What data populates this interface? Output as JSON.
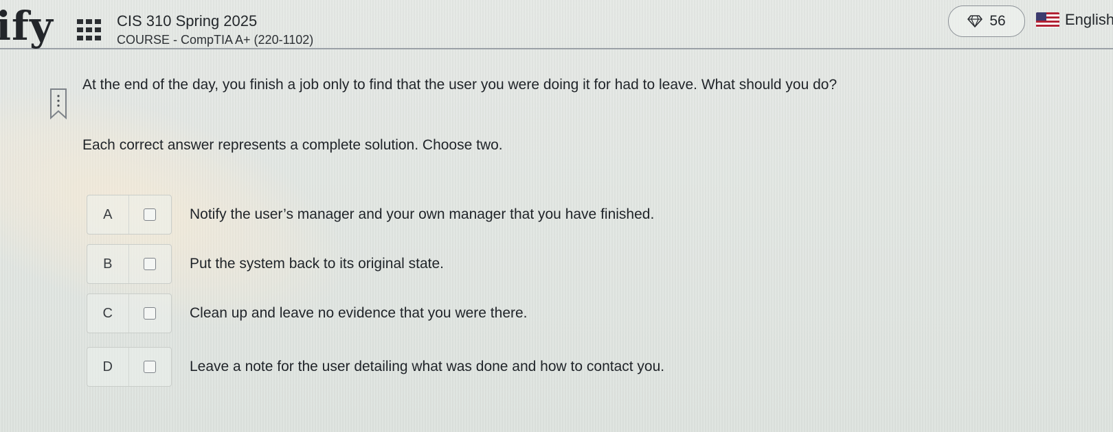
{
  "header": {
    "logo_text": "ify",
    "course_title": "CIS 310 Spring 2025",
    "course_subtitle": "COURSE - CompTIA A+ (220-1102)",
    "gem_count": "56",
    "language": "English"
  },
  "question": {
    "text": "At the end of the day, you finish a job only to find that the user you were doing it for had to leave. What should you do?",
    "instruction": "Each correct answer represents a complete solution. Choose two.",
    "options": [
      {
        "letter": "A",
        "text": "Notify the user’s manager and your own manager that you have finished.",
        "checked": false
      },
      {
        "letter": "B",
        "text": "Put the system back to its original state.",
        "checked": false
      },
      {
        "letter": "C",
        "text": "Clean up and leave no evidence that you were there.",
        "checked": false
      },
      {
        "letter": "D",
        "text": "Leave a note for the user detailing what was done and how to contact you.",
        "checked": false
      }
    ]
  },
  "colors": {
    "background": "#dfe3df",
    "text": "#1f2328",
    "flag_red": "#b22234",
    "flag_blue": "#3c3b6e"
  },
  "icons": {
    "menu": "grid-icon",
    "gems": "diamond-icon",
    "language": "us-flag-icon",
    "bookmark": "bookmark-icon"
  }
}
